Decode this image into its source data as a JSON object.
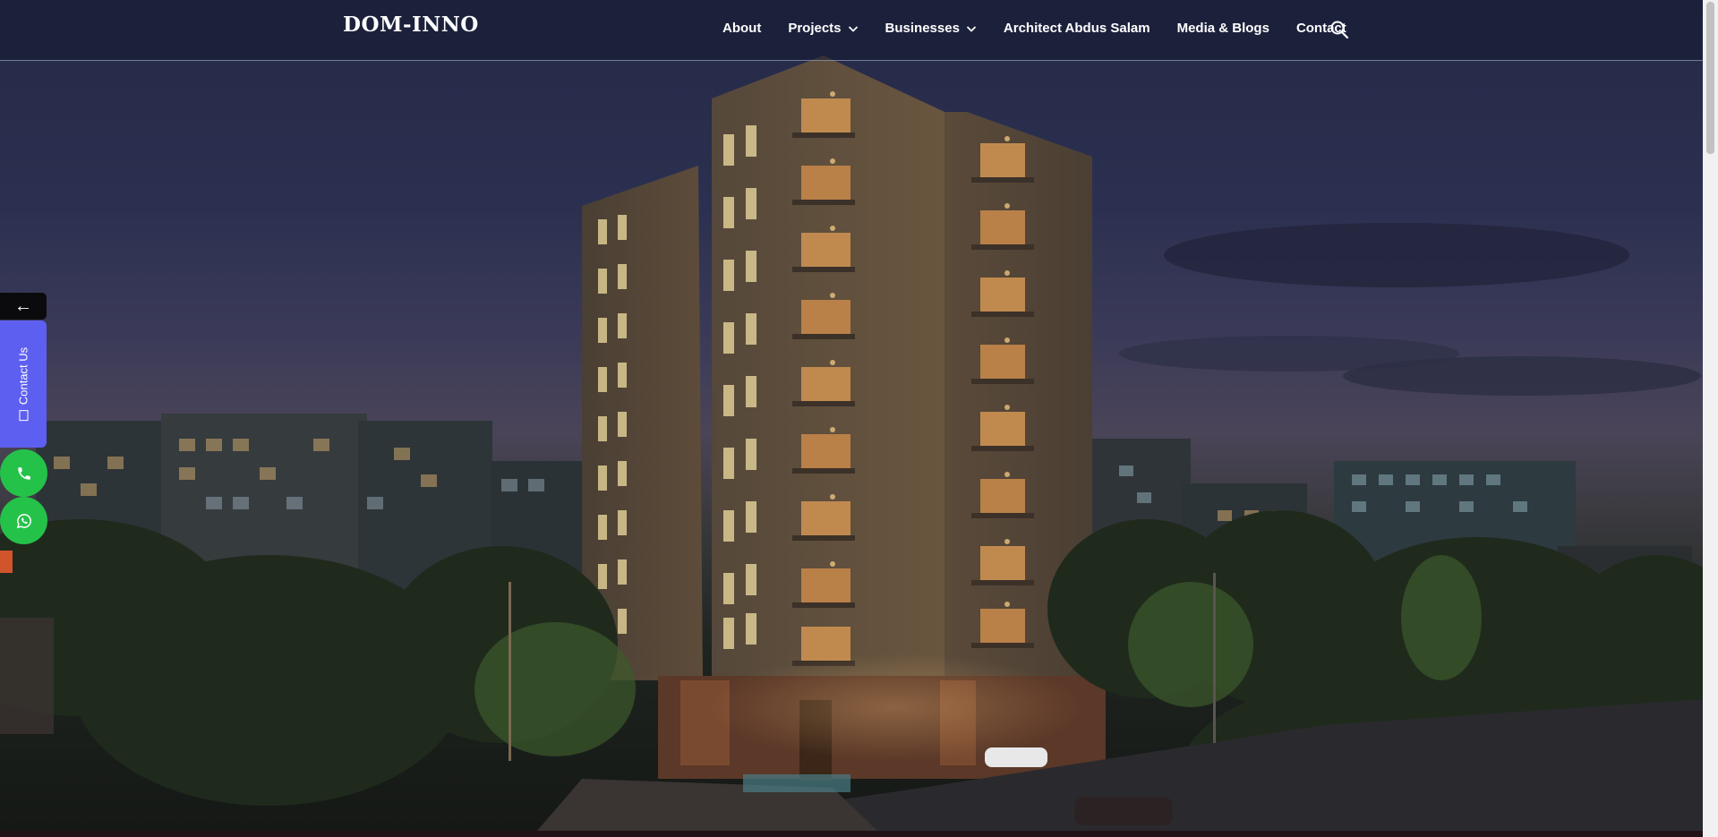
{
  "header": {
    "logo": "DOM-INNO",
    "nav": [
      {
        "label": "About",
        "has_dropdown": false
      },
      {
        "label": "Projects",
        "has_dropdown": true
      },
      {
        "label": "Businesses",
        "has_dropdown": true
      },
      {
        "label": "Architect Abdus Salam",
        "has_dropdown": false
      },
      {
        "label": "Media & Blogs",
        "has_dropdown": false
      },
      {
        "label": "Contact",
        "has_dropdown": false
      }
    ],
    "search_icon": "search-icon"
  },
  "side_widgets": {
    "toggle_arrow": "←",
    "contact_tab_label": "Contact Us",
    "phone_icon": "phone-icon",
    "whatsapp_icon": "whatsapp-icon"
  },
  "colors": {
    "contact_tab": "#5d5ff0",
    "call_buttons": "#25c24a",
    "header_border": "#bec8e6"
  }
}
